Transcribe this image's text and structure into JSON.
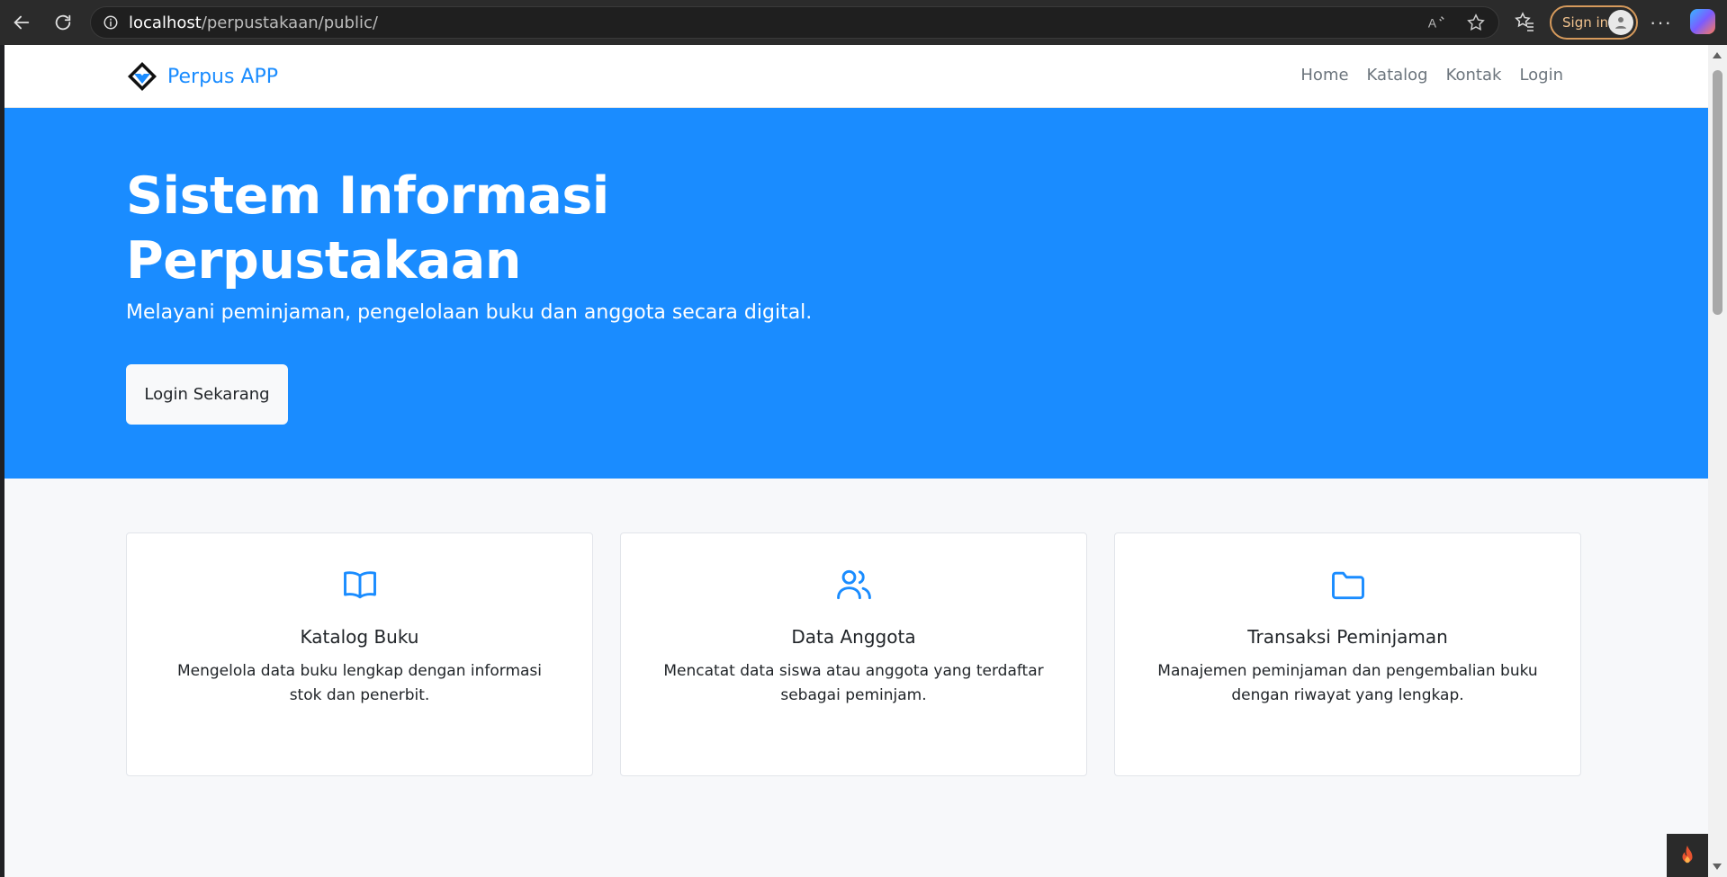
{
  "browser": {
    "url_host": "localhost",
    "url_path": "/perpustakaan/public/",
    "signin_label": "Sign in",
    "more_label": "···"
  },
  "navbar": {
    "brand": "Perpus APP",
    "links": [
      "Home",
      "Katalog",
      "Kontak",
      "Login"
    ]
  },
  "hero": {
    "title": "Sistem Informasi Perpustakaan",
    "lead": "Melayani peminjaman, pengelolaan buku dan anggota secara digital.",
    "cta": "Login Sekarang"
  },
  "features": [
    {
      "icon": "book-icon",
      "title": "Katalog Buku",
      "text": "Mengelola data buku lengkap dengan informasi stok dan penerbit."
    },
    {
      "icon": "people-icon",
      "title": "Data Anggota",
      "text": "Mencatat data siswa atau anggota yang terdaftar sebagai peminjam."
    },
    {
      "icon": "folder-icon",
      "title": "Transaksi Peminjaman",
      "text": "Manajemen peminjaman dan pengembalian buku dengan riwayat yang lengkap."
    }
  ],
  "colors": {
    "primary": "#1a8cff",
    "background": "#f7f8fa"
  }
}
